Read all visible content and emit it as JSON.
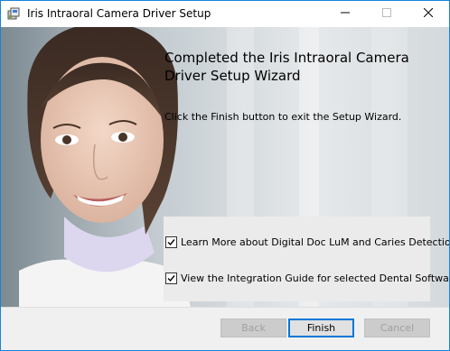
{
  "window": {
    "title": "Iris Intraoral Camera Driver Setup",
    "icons": {
      "app": "installer-icon",
      "minimize": "minimize-icon",
      "maximize": "maximize-icon",
      "close": "close-icon"
    }
  },
  "wizard": {
    "heading": "Completed the Iris Intraoral Camera Driver Setup Wizard",
    "instruction": "Click the Finish button to exit the Setup Wizard.",
    "options": [
      {
        "label": "Learn More about Digital Doc LuM and Caries Detection",
        "checked": true
      },
      {
        "label": "View the Integration Guide for selected Dental Software",
        "checked": true
      }
    ]
  },
  "buttons": {
    "back": "Back",
    "finish": "Finish",
    "cancel": "Cancel"
  },
  "colors": {
    "window_border": "#1883d7",
    "default_button_border": "#0078d7",
    "dialog_background": "#f0f0f0"
  }
}
